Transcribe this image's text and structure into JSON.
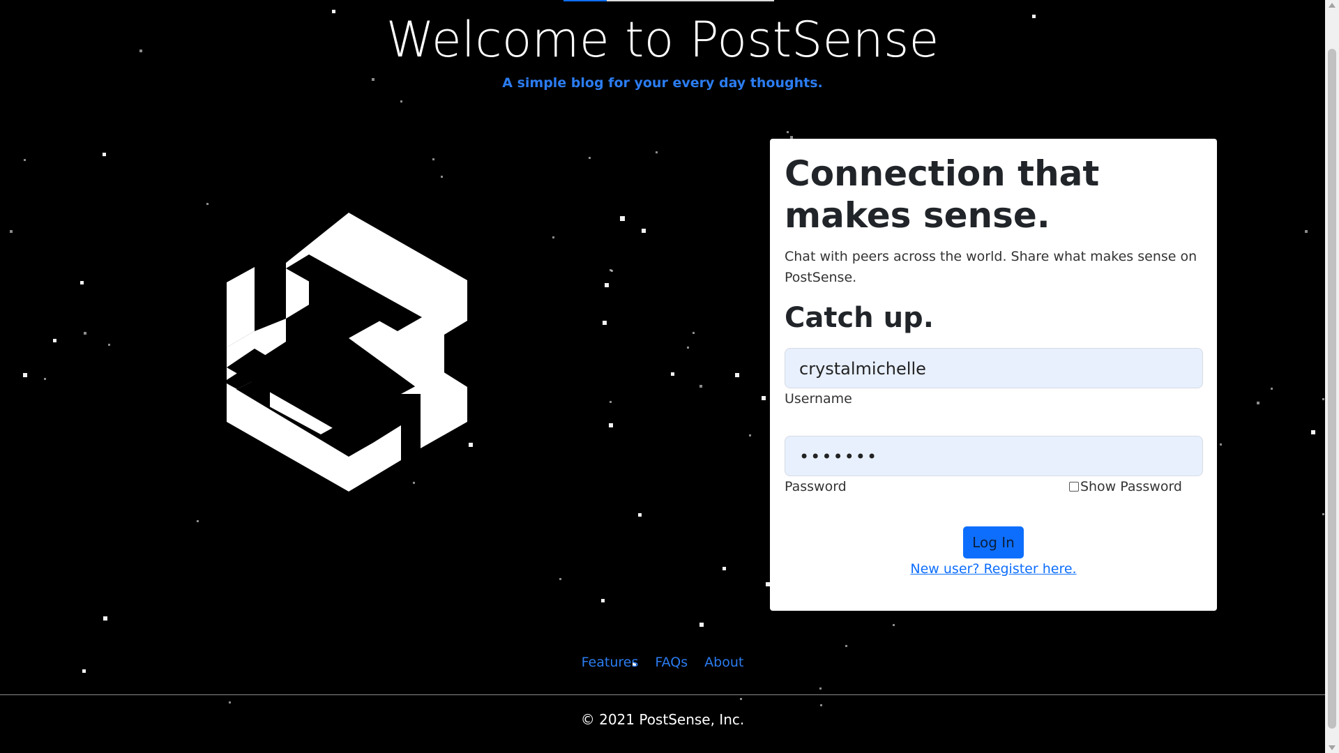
{
  "hero": {
    "title": "Welcome to PostSense",
    "subtitle": "A simple blog for your every day thoughts."
  },
  "logo": {
    "icon": "postsense-logo-icon"
  },
  "card": {
    "heading": "Connection that makes sense.",
    "text": "Chat with peers across the world. Share what makes sense on PostSense.",
    "subheading": "Catch up.",
    "username": {
      "value": "crystalmichelle",
      "label": "Username"
    },
    "password": {
      "value": "•••••••",
      "label": "Password",
      "show_label": "Show Password",
      "show_checked": false
    },
    "login_label": "Log In",
    "register_label": "New user? Register here."
  },
  "footer": {
    "links": [
      "Features",
      "FAQs",
      "About"
    ],
    "copyright": "© 2021 PostSense, Inc."
  },
  "colors": {
    "background": "#000000",
    "accent": "#0d6efd",
    "subtitle": "#2b7cf0",
    "field_bg": "#e8f0fe"
  }
}
